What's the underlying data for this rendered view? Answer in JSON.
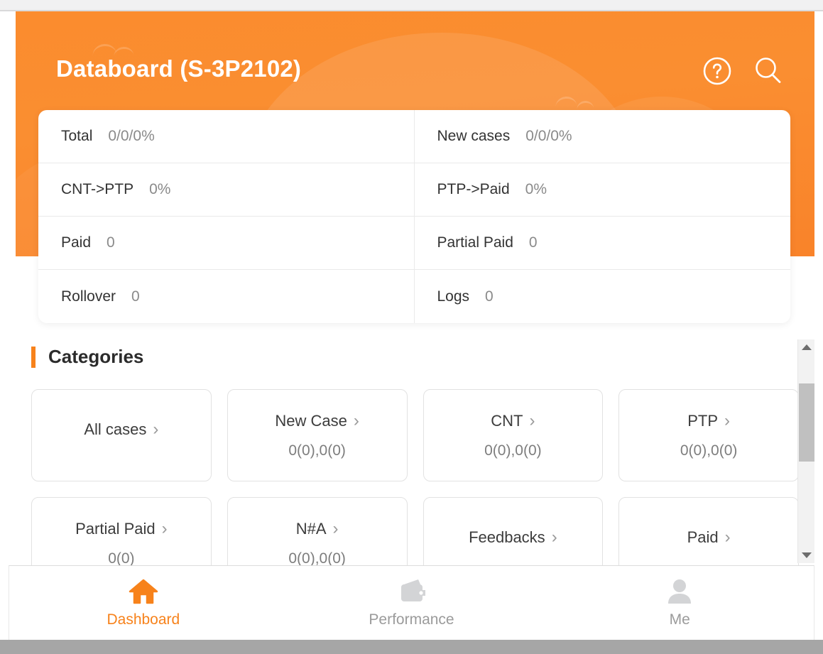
{
  "header": {
    "title": "Databoard (S-3P2102)",
    "accent_color": "#f7821b",
    "background_color": "#fb8c2e",
    "help_icon": "help-circle-icon",
    "search_icon": "search-icon"
  },
  "stats": {
    "rows": [
      [
        {
          "label": "Total",
          "value": "0/0/0%"
        },
        {
          "label": "New cases",
          "value": "0/0/0%"
        }
      ],
      [
        {
          "label": "CNT->PTP",
          "value": "0%"
        },
        {
          "label": "PTP->Paid",
          "value": "0%"
        }
      ],
      [
        {
          "label": "Paid",
          "value": "0"
        },
        {
          "label": "Partial Paid",
          "value": "0"
        }
      ],
      [
        {
          "label": "Rollover",
          "value": "0"
        },
        {
          "label": "Logs",
          "value": "0"
        }
      ]
    ]
  },
  "categories": {
    "title": "Categories",
    "chevron": "›",
    "items": [
      {
        "label": "All cases",
        "value": ""
      },
      {
        "label": "New Case",
        "value": "0(0),0(0)"
      },
      {
        "label": "CNT",
        "value": "0(0),0(0)"
      },
      {
        "label": "PTP",
        "value": "0(0),0(0)"
      },
      {
        "label": "Partial Paid",
        "value": "0(0)"
      },
      {
        "label": "N#A",
        "value": "0(0),0(0)"
      },
      {
        "label": "Feedbacks",
        "value": ""
      },
      {
        "label": "Paid",
        "value": ""
      }
    ]
  },
  "scrollbar": {
    "up_arrow": "scroll-up-arrow-icon",
    "down_arrow": "scroll-down-arrow-icon"
  },
  "bottom_nav": {
    "active_color": "#f7821b",
    "inactive_color": "#9b9b9b",
    "items": [
      {
        "label": "Dashboard",
        "icon": "home-icon",
        "active": true
      },
      {
        "label": "Performance",
        "icon": "wallet-icon",
        "active": false
      },
      {
        "label": "Me",
        "icon": "person-icon",
        "active": false
      }
    ]
  }
}
